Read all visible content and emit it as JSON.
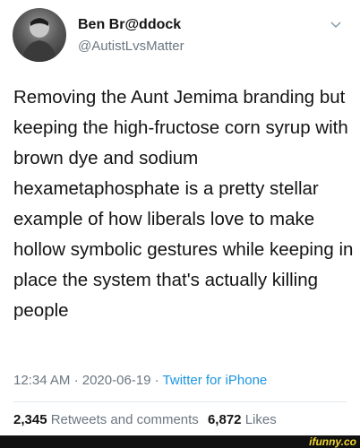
{
  "tweet": {
    "author_name": "Ben Br@ddock",
    "author_handle": "@AutistLvsMatter",
    "text": "Removing the Aunt Jemima branding but keeping the high-fructose corn syrup with brown dye and sodium hexametaphosphate is a pretty stellar example of how liberals love to make hollow symbolic gestures while keeping in place the system that's actually killing people",
    "time": "12:34 AM",
    "date": "2020-06-19",
    "separator": "·",
    "source": "Twitter for iPhone",
    "retweets_count": "2,345",
    "retweets_label": "Retweets and comments",
    "likes_count": "6,872",
    "likes_label": "Likes"
  },
  "footer": {
    "watermark": "ifunny.co"
  },
  "colors": {
    "link": "#1b95e0",
    "muted": "#6b7782",
    "text": "#141414",
    "watermark": "#f3d631"
  },
  "icons": {
    "avatar": "profile-photo",
    "menu": "chevron-down-icon"
  }
}
